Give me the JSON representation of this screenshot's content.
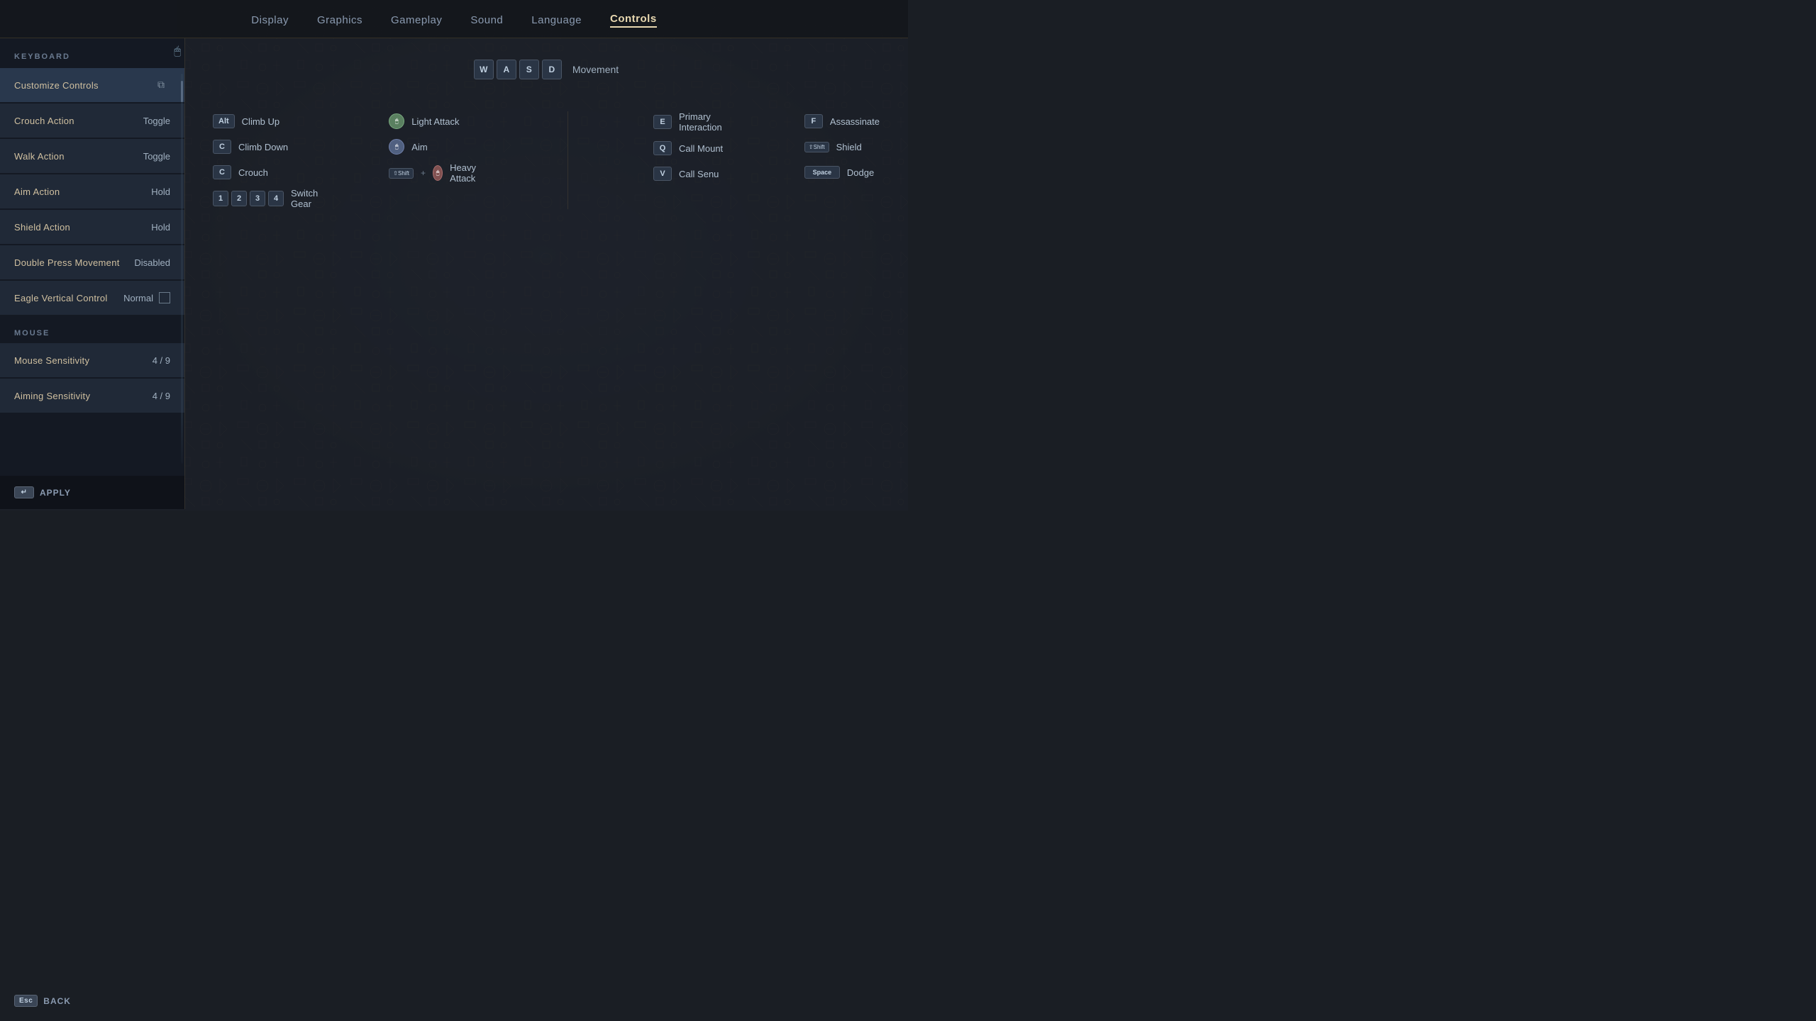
{
  "nav": {
    "items": [
      {
        "label": "Display",
        "active": false
      },
      {
        "label": "Graphics",
        "active": false
      },
      {
        "label": "Gameplay",
        "active": false
      },
      {
        "label": "Sound",
        "active": false
      },
      {
        "label": "Language",
        "active": false
      },
      {
        "label": "Controls",
        "active": true
      }
    ]
  },
  "sidebar": {
    "keyboard_section": "KEYBOARD",
    "mouse_section": "MOUSE",
    "items": [
      {
        "label": "Customize Controls",
        "value": "",
        "type": "header"
      },
      {
        "label": "Crouch Action",
        "value": "Toggle",
        "type": "setting"
      },
      {
        "label": "Walk Action",
        "value": "Toggle",
        "type": "setting"
      },
      {
        "label": "Aim Action",
        "value": "Hold",
        "type": "setting"
      },
      {
        "label": "Shield Action",
        "value": "Hold",
        "type": "setting"
      },
      {
        "label": "Double Press Movement",
        "value": "Disabled",
        "type": "setting"
      },
      {
        "label": "Eagle Vertical Control",
        "value": "Normal",
        "type": "setting_checkbox"
      }
    ],
    "mouse_items": [
      {
        "label": "Mouse Sensitivity",
        "value": "4 / 9",
        "type": "setting"
      },
      {
        "label": "Aiming Sensitivity",
        "value": "4 / 9",
        "type": "setting"
      }
    ]
  },
  "keybindings": {
    "movement": {
      "keys": [
        "W",
        "A",
        "S",
        "D"
      ],
      "label": "Movement"
    },
    "left_column": [
      {
        "key": "Alt",
        "action": "Climb Up",
        "key_type": "text"
      },
      {
        "key": "C",
        "action": "Climb Down",
        "key_type": "text"
      },
      {
        "key": "C",
        "action": "Crouch",
        "key_type": "text"
      },
      {
        "keys_gear": [
          "1",
          "2",
          "3",
          "4"
        ],
        "action": "Switch Gear",
        "key_type": "gear"
      }
    ],
    "attack_column": [
      {
        "key": "mouse_left",
        "action": "Light Attack",
        "key_type": "icon_green"
      },
      {
        "key": "mouse_right",
        "action": "Aim",
        "key_type": "icon_blue"
      },
      {
        "key": "shift_mouse",
        "action": "Heavy Attack",
        "key_type": "shift_combo"
      }
    ],
    "right_column": [
      {
        "key": "E",
        "action": "Primary Interaction",
        "key_type": "text"
      },
      {
        "key": "Q",
        "action": "Call Mount",
        "key_type": "text"
      },
      {
        "key": "V",
        "action": "Call Senu",
        "key_type": "text"
      }
    ],
    "right_attack_column": [
      {
        "key": "F",
        "action": "Assassinate",
        "key_type": "text"
      },
      {
        "key": "⇧Shift",
        "action": "Shield",
        "key_type": "shift"
      },
      {
        "key": "Space",
        "action": "Dodge",
        "key_type": "space"
      }
    ]
  },
  "bottom": {
    "apply_key": "↵",
    "apply_label": "APPLY",
    "back_key": "Esc",
    "back_label": "BACK"
  },
  "icons": {
    "copy": "⧉",
    "mouse_cursor": "🖱",
    "mouse_left": "◑",
    "mouse_right": "◐",
    "shield": "🛡"
  }
}
